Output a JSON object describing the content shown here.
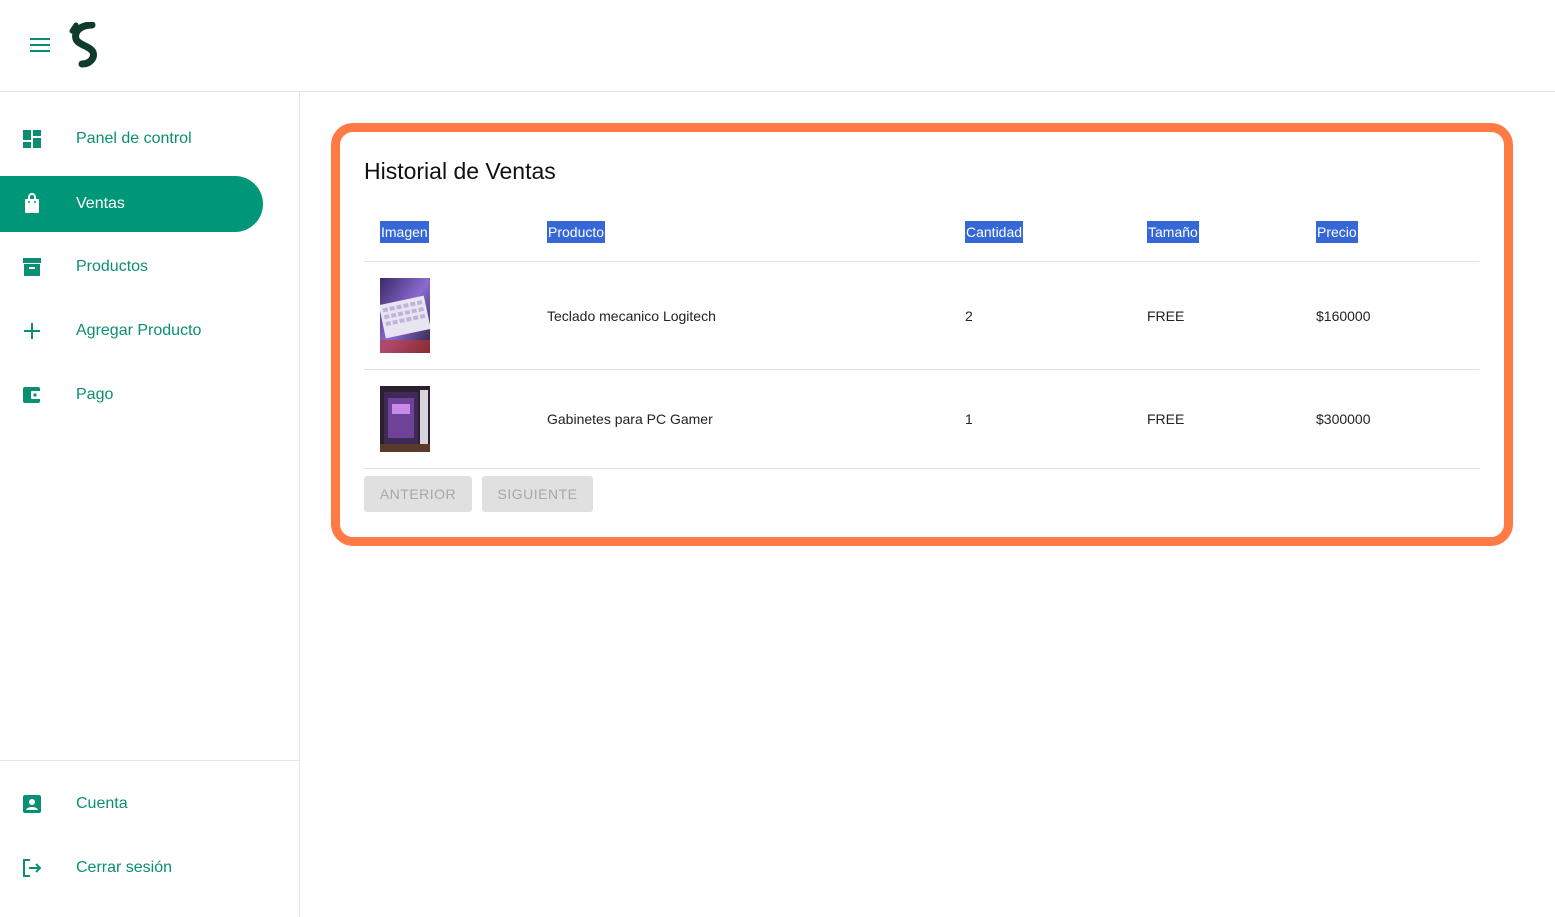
{
  "header": {
    "menu_icon": "hamburger-icon",
    "logo_icon": "s-logo-icon"
  },
  "sidebar": {
    "items": [
      {
        "label": "Panel de control",
        "icon": "dashboard-icon"
      },
      {
        "label": "Ventas",
        "icon": "shopping-bag-icon",
        "active": true
      },
      {
        "label": "Productos",
        "icon": "archive-icon"
      },
      {
        "label": "Agregar Producto",
        "icon": "plus-icon"
      },
      {
        "label": "Pago",
        "icon": "wallet-icon"
      }
    ],
    "bottom_items": [
      {
        "label": "Cuenta",
        "icon": "account-box-icon"
      },
      {
        "label": "Cerrar sesión",
        "icon": "logout-icon"
      }
    ]
  },
  "main": {
    "title": "Historial de Ventas",
    "columns": [
      "Imagen",
      "Producto",
      "Cantidad",
      "Tamaño",
      "Precio"
    ],
    "rows": [
      {
        "image": "keyboard-thumbnail",
        "product": "Teclado mecanico Logitech",
        "quantity": "2",
        "size": "FREE",
        "price": "$160000"
      },
      {
        "image": "pc-case-thumbnail",
        "product": "Gabinetes para PC Gamer",
        "quantity": "1",
        "size": "FREE",
        "price": "$300000"
      }
    ],
    "pagination": {
      "prev_label": "ANTERIOR",
      "next_label": "SIGUIENTE"
    }
  },
  "colors": {
    "accent": "#009678",
    "highlight_border": "#ff7a45",
    "header_bg": "#3567d6",
    "logo": "#0d3b2c"
  }
}
